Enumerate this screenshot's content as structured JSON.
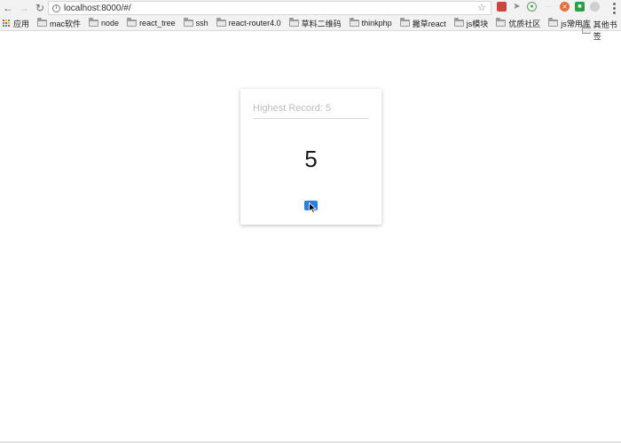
{
  "browser": {
    "url": "localhost:8000/#/",
    "bookmarks": [
      {
        "label": "mac软件"
      },
      {
        "label": "node"
      },
      {
        "label": "react_tree"
      },
      {
        "label": "ssh"
      },
      {
        "label": "react-router4.0"
      },
      {
        "label": "草料二维码"
      },
      {
        "label": "thinkphp"
      },
      {
        "label": "撇草react"
      },
      {
        "label": "js模块"
      },
      {
        "label": "优质社区"
      },
      {
        "label": "js常用库"
      }
    ],
    "apps_label": "应用",
    "overflow_label": "»",
    "other_bookmarks_label": "其他书签"
  },
  "card": {
    "record_label": "Highest Record:",
    "record_value": "5",
    "count": "5"
  },
  "colors": {
    "accent": "#2a7de1",
    "toolbar_bg": "#f2f2f2"
  },
  "icons": {
    "back": "arrow-left-icon",
    "forward": "arrow-right-icon",
    "reload": "reload-icon",
    "info": "info-icon",
    "star": "star-icon",
    "folder": "folder-icon",
    "apps": "apps-grid-icon",
    "play": "play-icon"
  }
}
